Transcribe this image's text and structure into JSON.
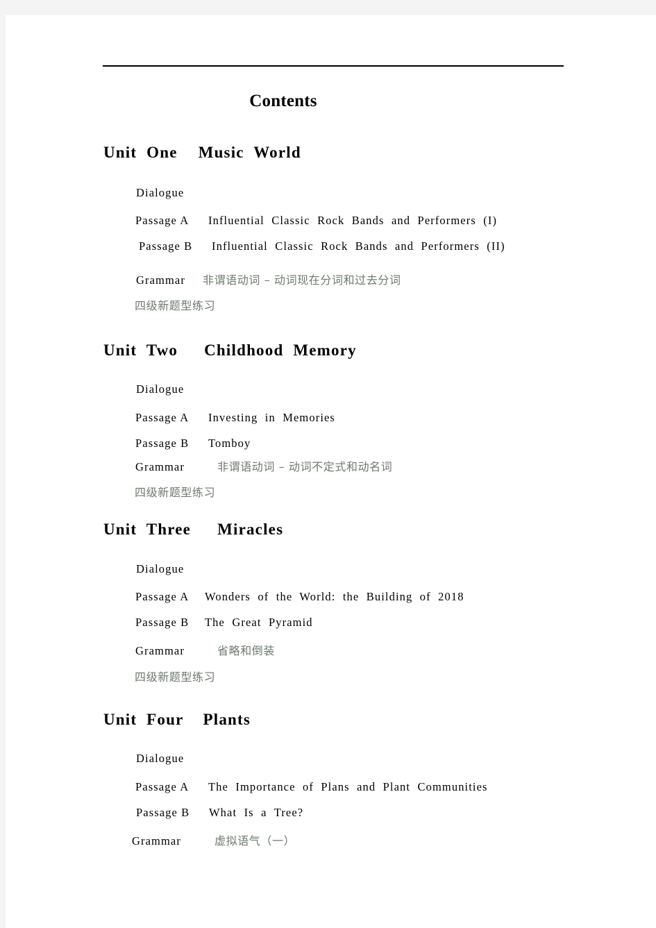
{
  "document": {
    "title": "Contents",
    "rule_color": "#000000",
    "chinese_text_color": "#6d7a6d",
    "body_text_color": "#000000",
    "page_background": "#ffffff",
    "canvas_background": "#f4f4f4"
  },
  "units": [
    {
      "number": "Unit  One",
      "title": "Music  World",
      "entries": [
        {
          "label": "Dialogue",
          "value": ""
        },
        {
          "label": "Passage A",
          "value": "Influential  Classic  Rock  Bands  and  Performers  (I)"
        },
        {
          "label": "Passage B",
          "value": "Influential  Classic  Rock  Bands  and  Performers  (II)"
        },
        {
          "label": "Grammar",
          "value_cn": "非谓语动词 – 动词现在分词和过去分词"
        }
      ],
      "footer_cn": "四级新题型练习"
    },
    {
      "number": "Unit  Two",
      "title": "Childhood  Memory",
      "entries": [
        {
          "label": "Dialogue",
          "value": ""
        },
        {
          "label": "Passage A",
          "value": "Investing  in  Memories"
        },
        {
          "label": "Passage B",
          "value": "Tomboy"
        },
        {
          "label": "Grammar",
          "value_cn": "非谓语动词 – 动词不定式和动名词"
        }
      ],
      "footer_cn": "四级新题型练习"
    },
    {
      "number": "Unit  Three",
      "title": "Miracles",
      "entries": [
        {
          "label": "Dialogue",
          "value": ""
        },
        {
          "label": "Passage A",
          "value": "Wonders  of  the  World:  the  Building  of  2018"
        },
        {
          "label": "Passage B",
          "value": "The  Great  Pyramid"
        },
        {
          "label": "Grammar",
          "value_cn": "省略和倒装"
        }
      ],
      "footer_cn": "四级新题型练习"
    },
    {
      "number": "Unit  Four",
      "title": "Plants",
      "entries": [
        {
          "label": "Dialogue",
          "value": ""
        },
        {
          "label": "Passage A",
          "value": "The  Importance  of  Plans  and  Plant  Communities"
        },
        {
          "label": "Passage B",
          "value": "What  Is  a  Tree?"
        },
        {
          "label": "Grammar",
          "value_cn": "虚拟语气（一）"
        }
      ],
      "footer_cn": ""
    }
  ]
}
